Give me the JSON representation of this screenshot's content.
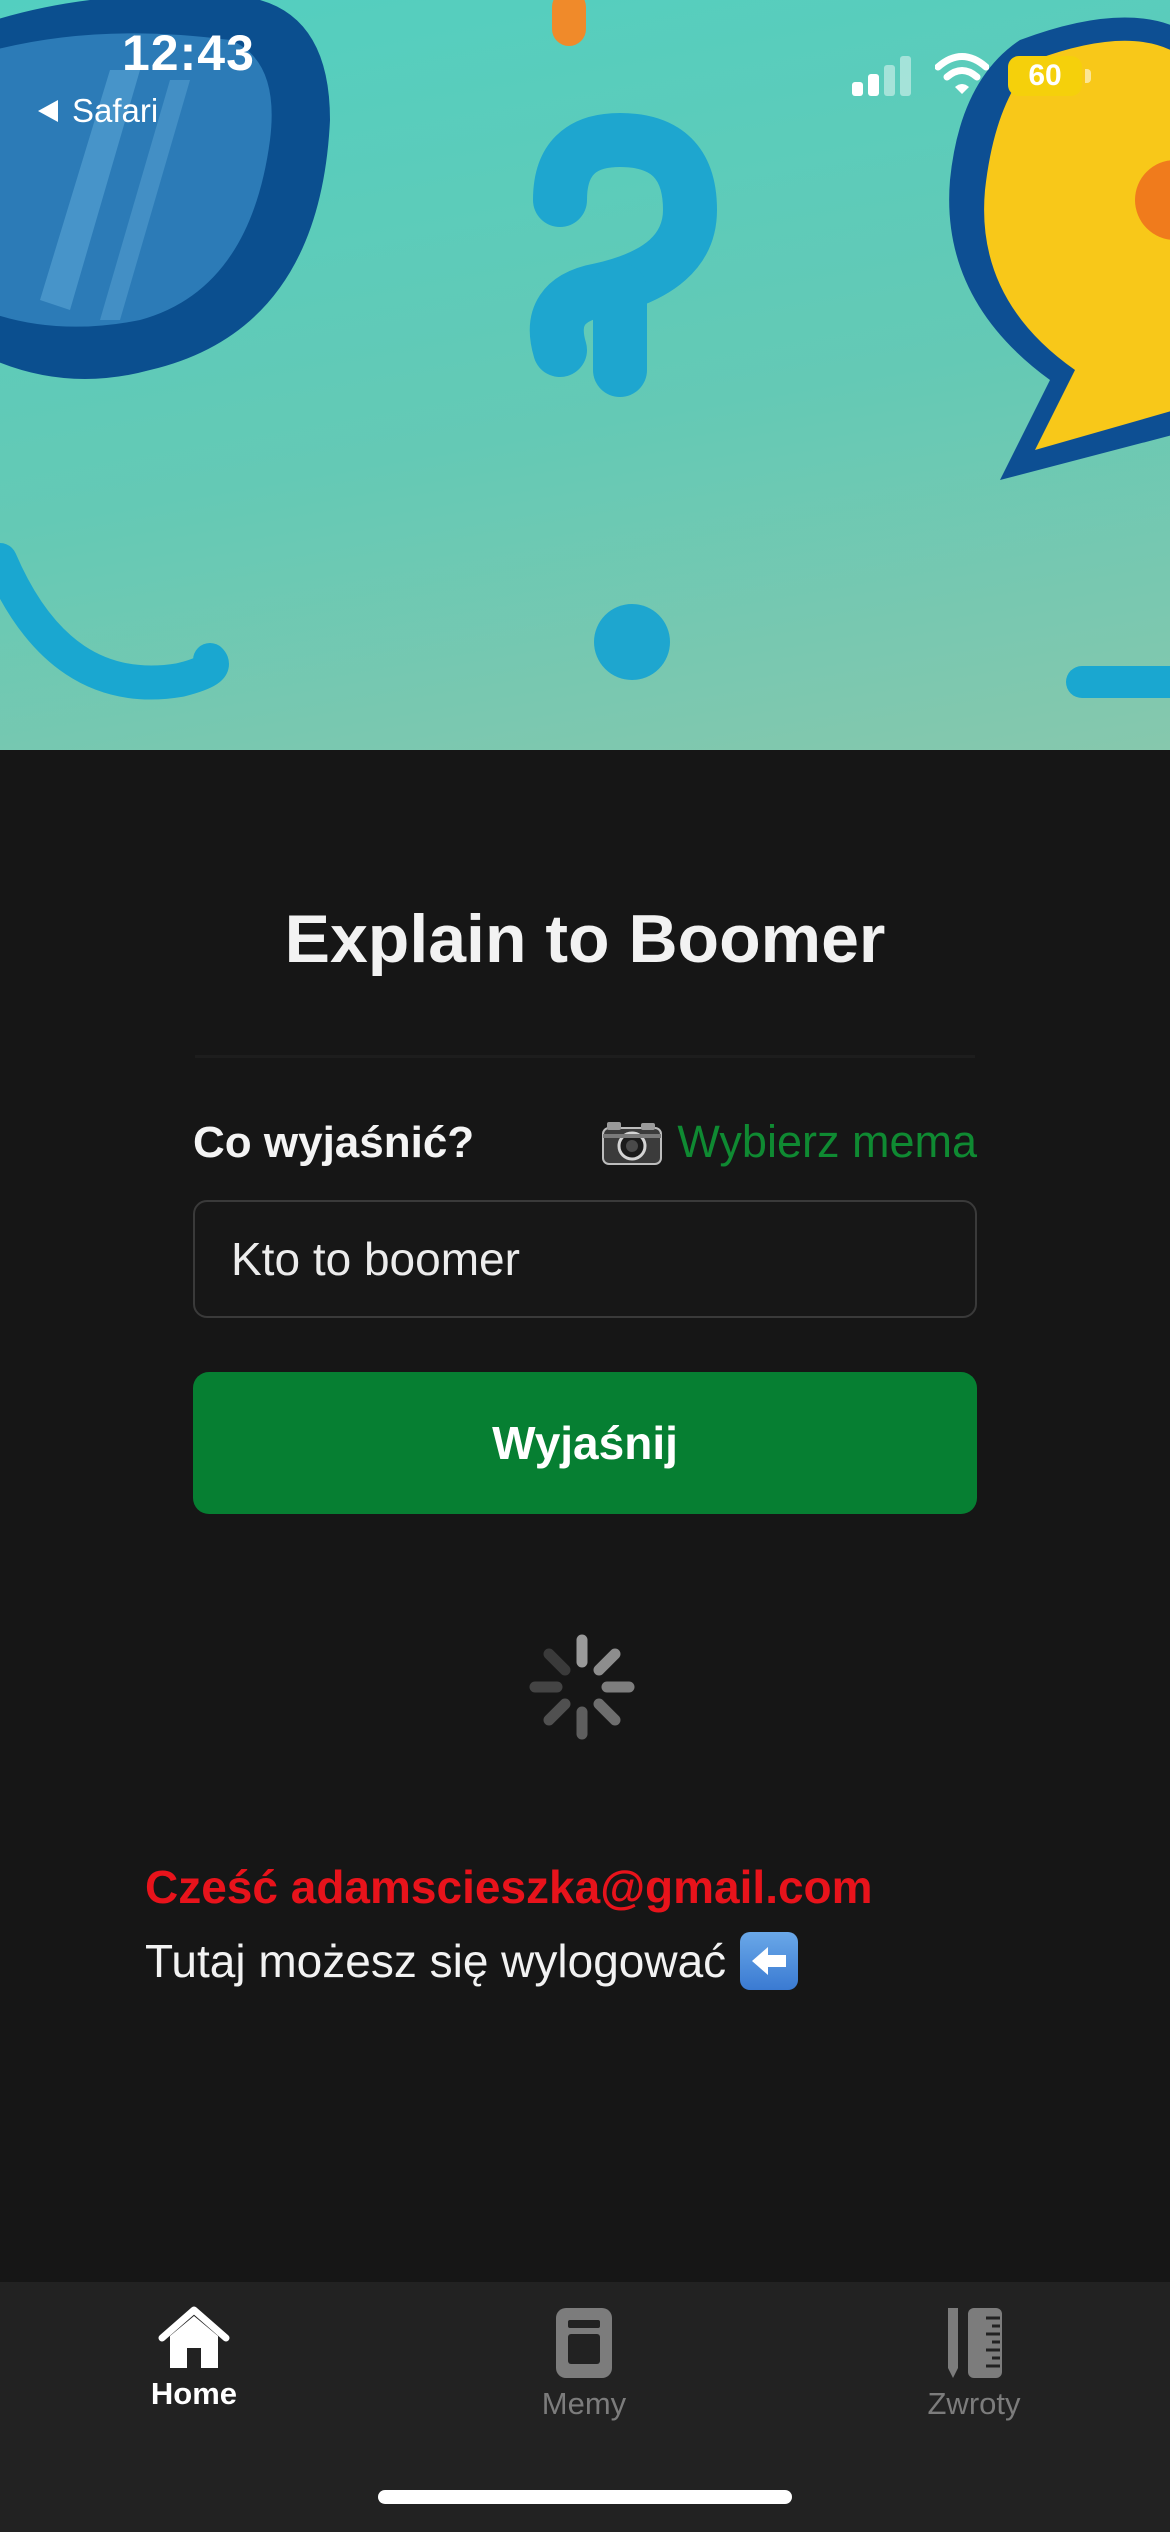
{
  "status_bar": {
    "time": "12:43",
    "back_label": "Safari",
    "battery": "60"
  },
  "main": {
    "title": "Explain to Boomer",
    "field_label": "Co wyjaśnić?",
    "meme_link": "Wybierz mema",
    "query_value": "Kto to boomer",
    "explain_button": "Wyjaśnij"
  },
  "account": {
    "greeting": "Cześć adamscieszka@gmail.com",
    "logout_text": "Tutaj możesz się wylogować"
  },
  "tabs": [
    {
      "label": "Home",
      "icon": "house-icon",
      "active": true
    },
    {
      "label": "Memy",
      "icon": "newspaper-icon",
      "active": false
    },
    {
      "label": "Zwroty",
      "icon": "ruler-pencil-icon",
      "active": false
    }
  ],
  "colors": {
    "background": "#161616",
    "accent_green": "#067f32",
    "link_green": "#0f8a32",
    "greeting_red": "#e8131b",
    "hero_teal": "#5ccdbb"
  }
}
